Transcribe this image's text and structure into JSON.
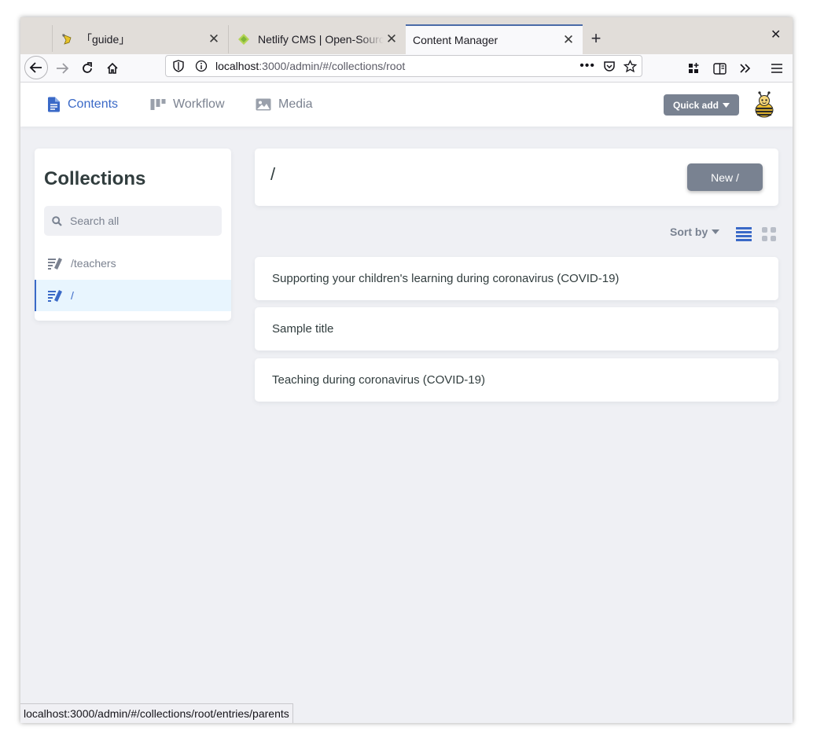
{
  "browser": {
    "tabs": [
      {
        "title": "「guide」",
        "favicon": "guide-favicon-icon"
      },
      {
        "title": "Netlify CMS | Open-Source",
        "favicon": "netlify-icon"
      },
      {
        "title": "Content Manager",
        "favicon": null
      }
    ],
    "url_host": "localhost",
    "url_rest": ":3000/admin/#/collections/root",
    "status_url": "localhost:3000/admin/#/collections/root/entries/parents"
  },
  "header": {
    "nav": [
      {
        "label": "Contents",
        "icon": "document-icon",
        "active": true
      },
      {
        "label": "Workflow",
        "icon": "workflow-icon",
        "active": false
      },
      {
        "label": "Media",
        "icon": "media-icon",
        "active": false
      }
    ],
    "quick_add_label": "Quick add"
  },
  "sidebar": {
    "title": "Collections",
    "search_placeholder": "Search all",
    "items": [
      {
        "label": "/teachers",
        "icon": "write-icon",
        "active": false
      },
      {
        "label": "/",
        "icon": "write-icon",
        "active": true
      }
    ]
  },
  "main": {
    "collection_title": "/",
    "new_button_label": "New /",
    "sort_label": "Sort by",
    "entries": [
      {
        "title": "Supporting your children's learning during coronavirus (COVID-19)"
      },
      {
        "title": "Sample title"
      },
      {
        "title": "Teaching during coronavirus (COVID-19)"
      }
    ]
  },
  "colors": {
    "accent": "#3a69c7",
    "button_gray": "#798291",
    "background": "#eff0f4"
  }
}
